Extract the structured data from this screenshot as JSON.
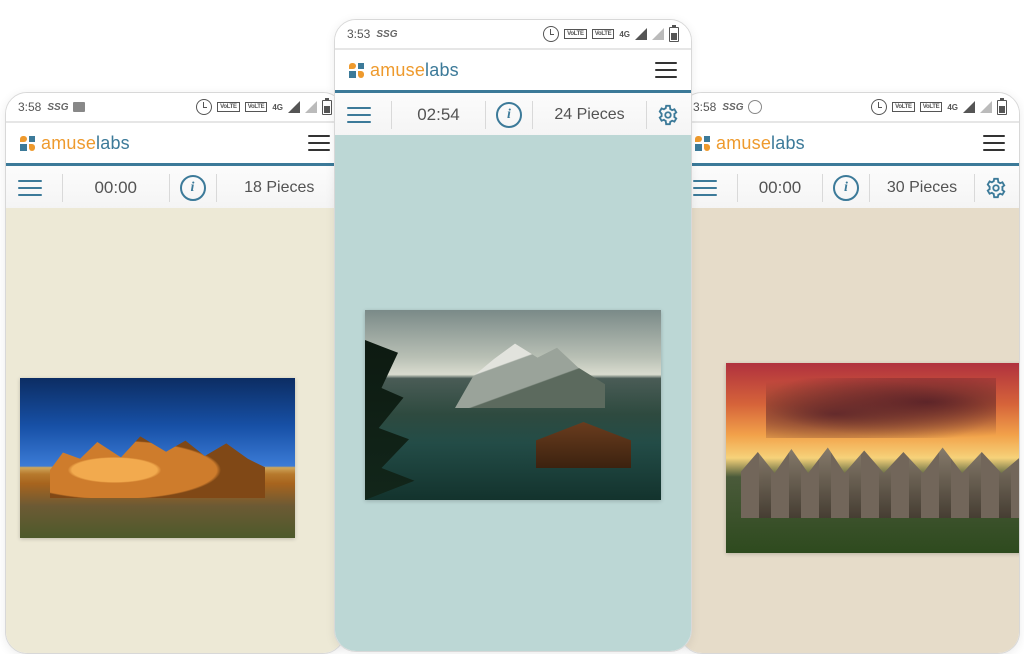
{
  "brand": {
    "part1": "amuse",
    "part2": "labs"
  },
  "phones": {
    "left": {
      "status_time": "3:58",
      "ssg": "SSG",
      "timer": "00:00",
      "pieces": "18 Pieces",
      "has_settings": false,
      "canvas_bg": "#ede9d6",
      "image_subject": "desert-rock-formation"
    },
    "center": {
      "status_time": "3:53",
      "ssg": "SSG",
      "timer": "02:54",
      "pieces": "24 Pieces",
      "has_settings": true,
      "canvas_bg": "#bcd7d5",
      "image_subject": "alpine-lake-mountains"
    },
    "right": {
      "status_time": "3:58",
      "ssg": "SSG",
      "timer": "00:00",
      "pieces": "30 Pieces",
      "has_settings": true,
      "canvas_bg": "#e6dcc9",
      "image_subject": "stonehenge-sunset"
    }
  },
  "status_icons": [
    "alarm",
    "lte",
    "lte",
    "4g",
    "signal",
    "signal",
    "battery"
  ],
  "colors": {
    "accent": "#3c7a99",
    "brand_orange": "#ee9a2d"
  }
}
